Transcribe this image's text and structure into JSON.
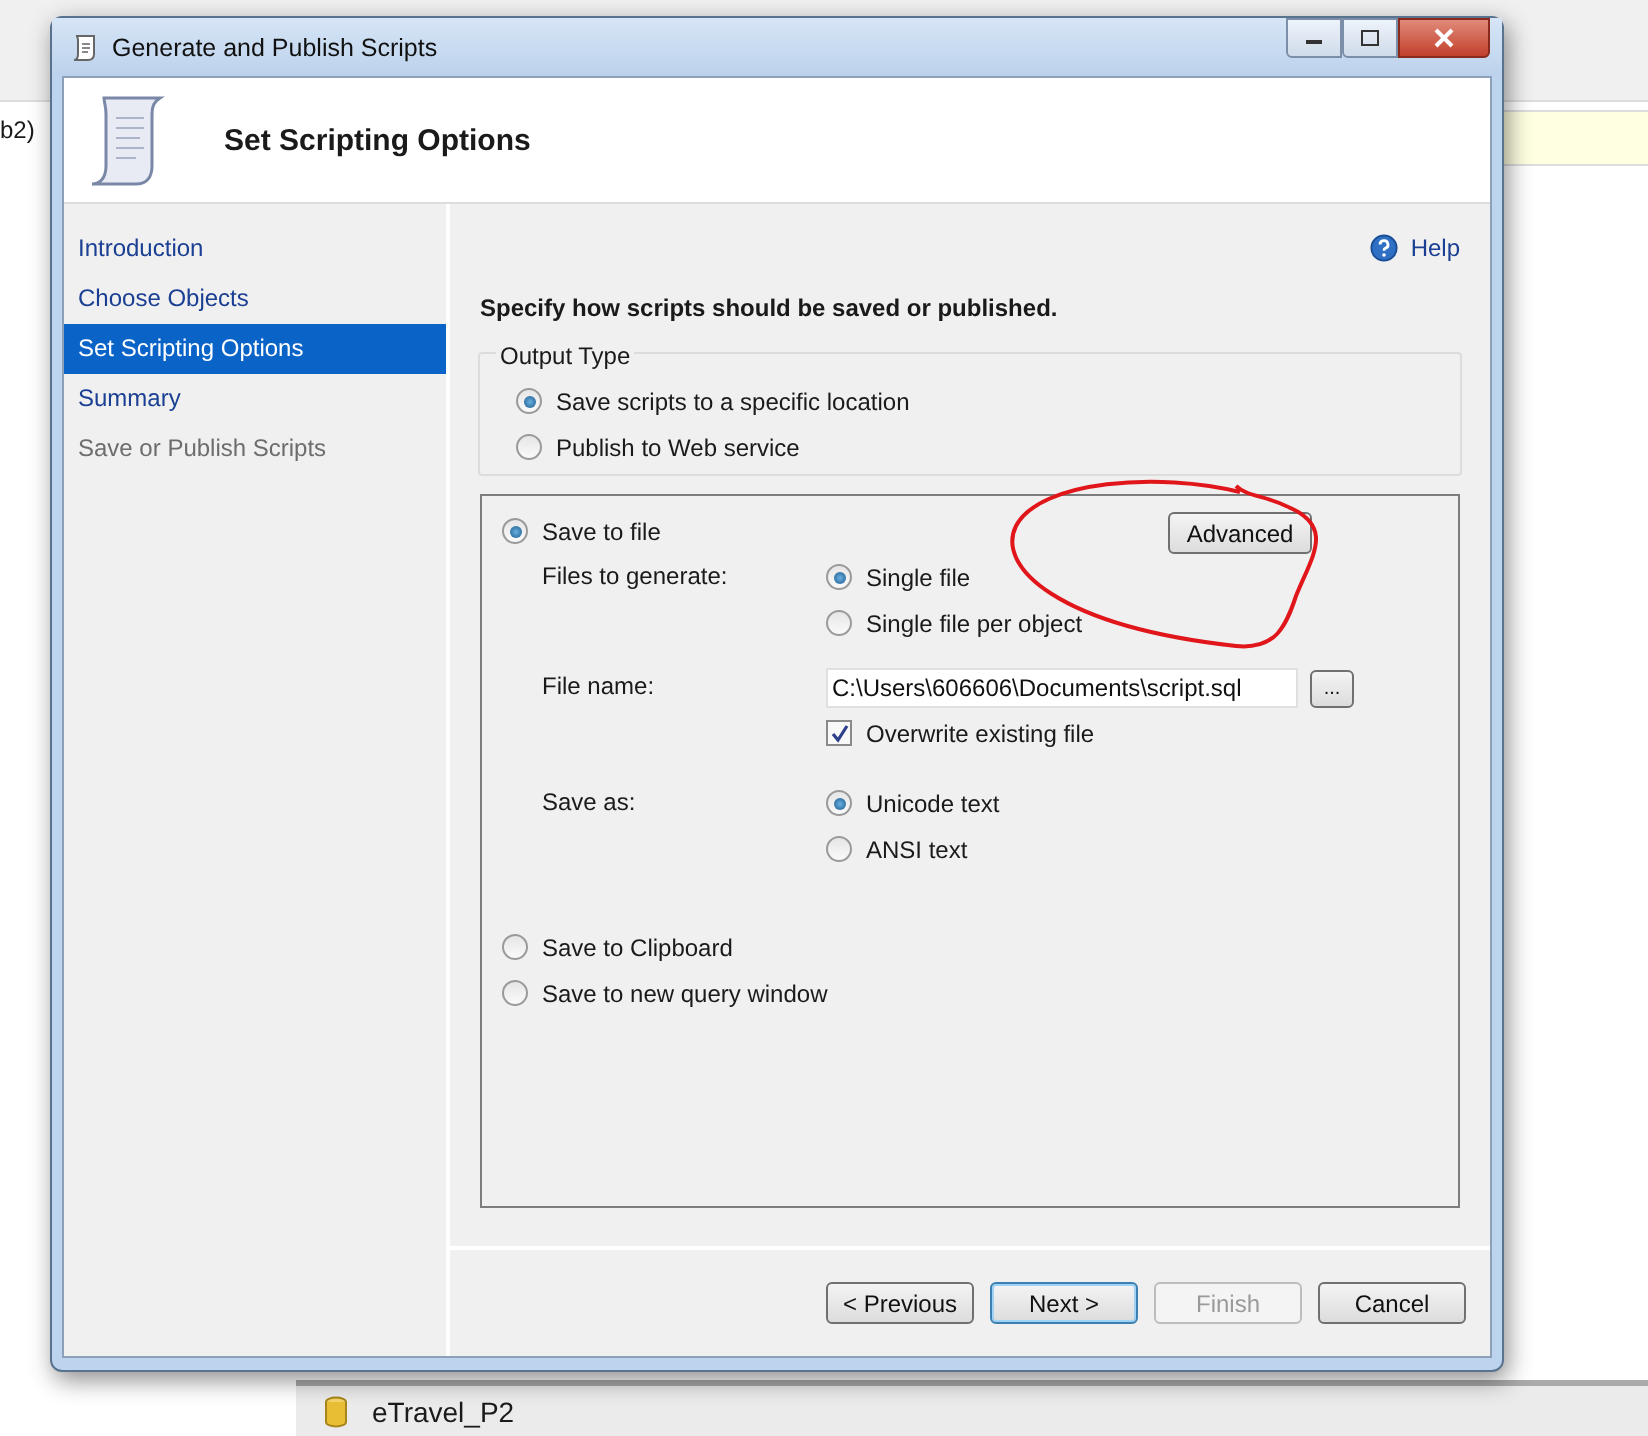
{
  "background": {
    "left_text": "b2)",
    "tree_item": "eTravel_P2"
  },
  "window": {
    "title": "Generate and Publish Scripts"
  },
  "header": {
    "title": "Set Scripting Options"
  },
  "nav": [
    {
      "label": "Introduction",
      "selected": false,
      "disabled": false
    },
    {
      "label": "Choose Objects",
      "selected": false,
      "disabled": false
    },
    {
      "label": "Set Scripting Options",
      "selected": true,
      "disabled": false
    },
    {
      "label": "Summary",
      "selected": false,
      "disabled": false
    },
    {
      "label": "Save or Publish Scripts",
      "selected": false,
      "disabled": true
    }
  ],
  "help": "Help",
  "instruction": "Specify how scripts should be saved or published.",
  "output_type": {
    "legend": "Output Type",
    "options": [
      {
        "label": "Save scripts to a specific location",
        "selected": true
      },
      {
        "label": "Publish to Web service",
        "selected": false
      }
    ]
  },
  "destination": {
    "options": [
      {
        "label": "Save to file",
        "selected": true
      },
      {
        "label": "Save to Clipboard",
        "selected": false
      },
      {
        "label": "Save to new query window",
        "selected": false
      }
    ],
    "advanced": "Advanced",
    "files_label": "Files to generate:",
    "files_options": [
      {
        "label": "Single file",
        "selected": true
      },
      {
        "label": "Single file per object",
        "selected": false
      }
    ],
    "file_name_label": "File name:",
    "file_name": "C:\\Users\\606606\\Documents\\script.sql",
    "browse": "...",
    "overwrite": {
      "label": "Overwrite existing file",
      "checked": true
    },
    "save_as_label": "Save as:",
    "save_as_options": [
      {
        "label": "Unicode text",
        "selected": true
      },
      {
        "label": "ANSI text",
        "selected": false
      }
    ]
  },
  "buttons": [
    {
      "label": "< Previous",
      "disabled": false,
      "default": false
    },
    {
      "label": "Next >",
      "disabled": false,
      "default": true
    },
    {
      "label": "Finish",
      "disabled": true,
      "default": false
    },
    {
      "label": "Cancel",
      "disabled": false,
      "default": false
    }
  ]
}
